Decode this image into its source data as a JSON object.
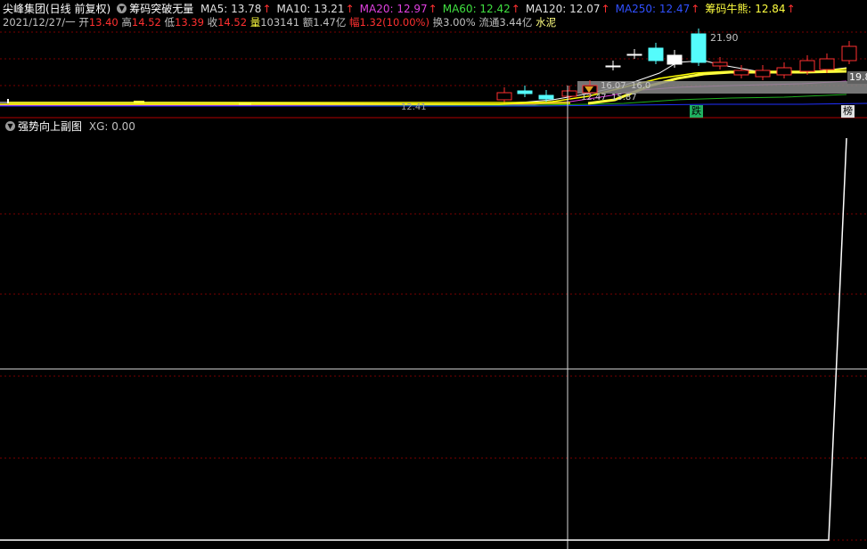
{
  "header": {
    "stock_name": "尖峰集团(日线 前复权)",
    "indicator_name": "筹码突破无量",
    "ma": [
      {
        "label": "MA5: 13.78",
        "color": "#e0e0e0"
      },
      {
        "label": "MA10: 13.21",
        "color": "#e0e0e0"
      },
      {
        "label": "MA20: 12.97",
        "color": "#e040e0"
      },
      {
        "label": "MA60: 12.42",
        "color": "#40e040"
      },
      {
        "label": "MA120: 12.07",
        "color": "#e0e0e0"
      },
      {
        "label": "MA250: 12.47",
        "color": "#3050ff"
      },
      {
        "label": "筹码牛熊: 12.84",
        "color": "#ffff40"
      }
    ]
  },
  "ohlc": {
    "date": "2021/12/27/一",
    "open_label": "开",
    "open": "13.40",
    "high_label": "高",
    "high": "14.52",
    "low_label": "低",
    "low": "13.39",
    "close_label": "收",
    "close": "14.52",
    "volume_label": "量",
    "volume": "103141",
    "amount_label": "额",
    "amount": "1.47亿",
    "change_label": "幅",
    "change": "1.32(10.00%)",
    "turnover_label": "换",
    "turnover": "3.00%",
    "float_label": "流通",
    "float": "3.44亿",
    "sector": "水泥"
  },
  "main_chart": {
    "price_labels": {
      "high": "21.90",
      "right": "19.8",
      "left_low": "12.41",
      "cursor_1": "16.07",
      "cursor_2": "16.0",
      "cursor_3": "12.47",
      "cursor_4": "15.87"
    },
    "markers": {
      "drop": "跌",
      "list": "榜"
    }
  },
  "sub_chart": {
    "title": "强势向上副图",
    "value_label": "XG: 0.00"
  },
  "colors": {
    "background": "#000000",
    "grid": "#8b0000",
    "up": "#ff3030",
    "down": "#54fcfc",
    "ma5": "#ffffff",
    "ma10": "#ffff00",
    "ma20": "#ff40ff",
    "ma60": "#00c000",
    "ma250": "#0000ff"
  }
}
